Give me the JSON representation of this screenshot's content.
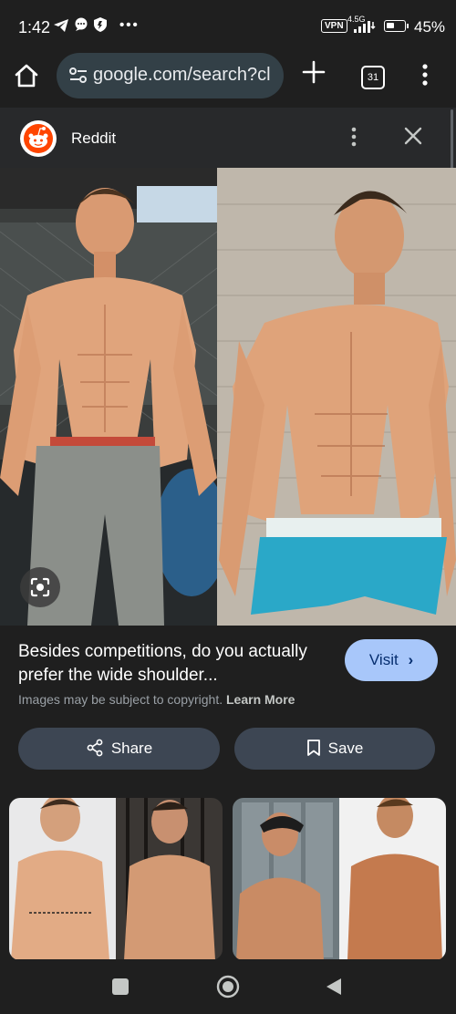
{
  "status_bar": {
    "time": "1:42",
    "vpn": "VPN",
    "network": "4.5G",
    "battery_percent": "45%",
    "battery_level": 0.45,
    "icons": [
      "telegram-icon",
      "chat-bubble-icon",
      "shield-icon",
      "more-dots-icon",
      "signal-icon",
      "battery-icon"
    ]
  },
  "browser": {
    "url": "google.com/search?cl",
    "tab_count": "31",
    "icons": [
      "home-icon",
      "tune-icon",
      "plus-icon",
      "tab-switcher-icon",
      "overflow-menu-icon"
    ]
  },
  "source": {
    "name": "Reddit",
    "icons": [
      "reddit-logo",
      "more-vert-icon",
      "close-icon"
    ]
  },
  "result": {
    "title": "Besides competitions, do you actually prefer the wide shoulder...",
    "visit_label": "Visit",
    "copyright_text": "Images may be subject to copyright.",
    "learn_more": "Learn More",
    "share_label": "Share",
    "save_label": "Save"
  },
  "nav_bar": {
    "icons": [
      "recents-icon",
      "home-circle-icon",
      "back-icon"
    ]
  },
  "colors": {
    "background": "#1f1f1f",
    "url_bar": "#334047",
    "visit_button": "#a8c7fa",
    "pill_button": "#3d4653",
    "reddit_orange": "#ff4500"
  }
}
